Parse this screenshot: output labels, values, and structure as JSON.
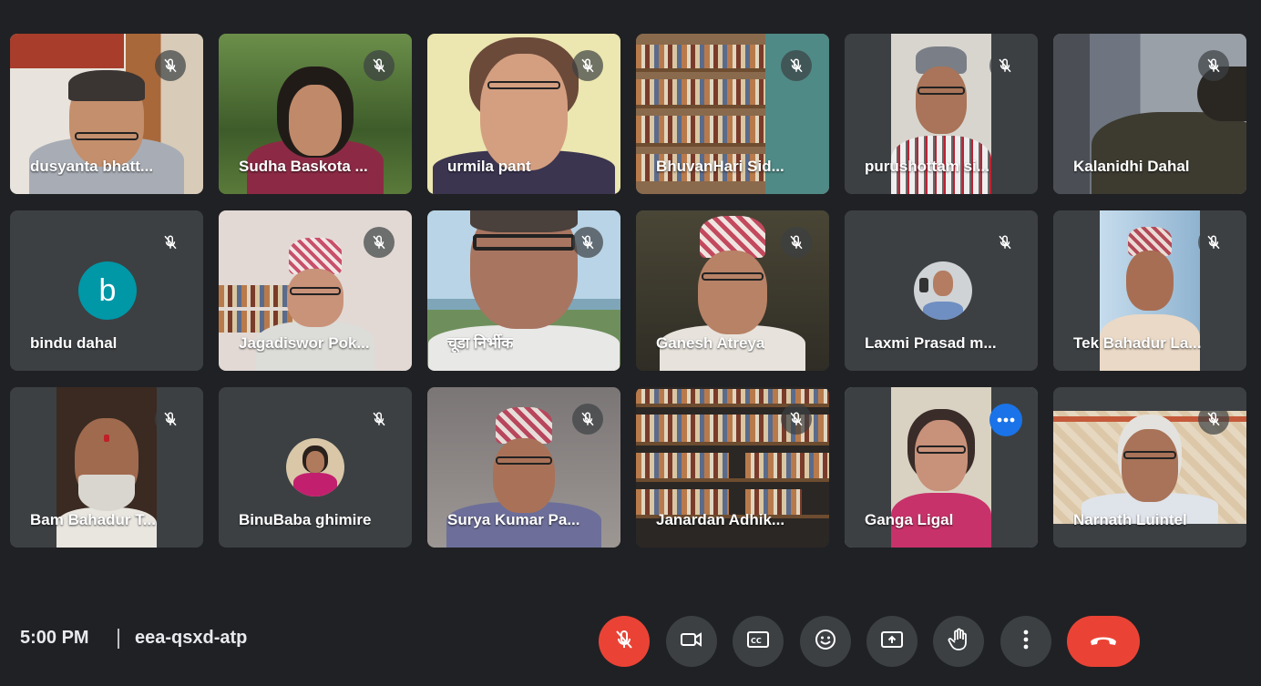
{
  "participants": [
    {
      "name": "dusyanta bhatt...",
      "muted": true
    },
    {
      "name": "Sudha Baskota ...",
      "muted": true
    },
    {
      "name": "urmila pant",
      "muted": true
    },
    {
      "name": "BhuvanHari Sid...",
      "muted": true
    },
    {
      "name": "purushottam si...",
      "muted": true
    },
    {
      "name": "Kalanidhi Dahal",
      "muted": true
    },
    {
      "name": "bindu dahal",
      "muted": true,
      "avatar_letter": "b",
      "avatar_color": "#0097a7"
    },
    {
      "name": "Jagadiswor Pok...",
      "muted": true
    },
    {
      "name": "चूडा निर्भीक",
      "muted": true
    },
    {
      "name": "Ganesh Atreya",
      "muted": true
    },
    {
      "name": "Laxmi Prasad m...",
      "muted": true
    },
    {
      "name": "Tek Bahadur La...",
      "muted": true
    },
    {
      "name": "Bam Bahadur T...",
      "muted": true
    },
    {
      "name": "BinuBaba ghimire",
      "muted": true
    },
    {
      "name": "Surya Kumar Pa...",
      "muted": true
    },
    {
      "name": "Janardan Adhik...",
      "muted": true
    },
    {
      "name": "Ganga Ligal",
      "muted": false,
      "active_speaker": true
    },
    {
      "name": "Narnath Luintel",
      "muted": true
    }
  ],
  "meeting": {
    "time": "5:00 PM",
    "code": "eea-qsxd-atp"
  },
  "controls": {
    "mic": "mic-off-icon",
    "camera": "camera-icon",
    "captions": "captions-icon",
    "emoji": "emoji-icon",
    "present": "present-screen-icon",
    "hand": "raise-hand-icon",
    "more": "more-options-icon",
    "end": "end-call-icon"
  },
  "colors": {
    "background": "#202124",
    "tile": "#3c4043",
    "accent": "#8ab4f8",
    "danger": "#ea4335",
    "more_button": "#1a73e8"
  }
}
